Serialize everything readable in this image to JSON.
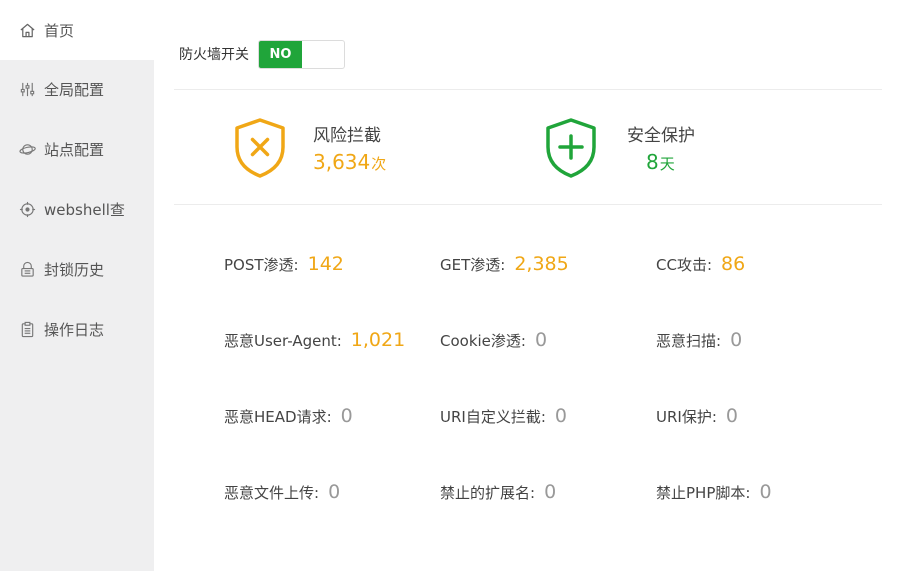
{
  "colors": {
    "accent_green": "#20a53a",
    "accent_orange": "#f0a716",
    "sidebar_bg": "#efeff0"
  },
  "sidebar": {
    "items": [
      {
        "label": "首页",
        "icon": "home-icon",
        "active": true
      },
      {
        "label": "全局配置",
        "icon": "sliders-icon",
        "active": false
      },
      {
        "label": "站点配置",
        "icon": "planet-icon",
        "active": false
      },
      {
        "label": "webshell查",
        "icon": "crosshair-icon",
        "active": false
      },
      {
        "label": "封锁历史",
        "icon": "lock-icon",
        "active": false
      },
      {
        "label": "操作日志",
        "icon": "clipboard-icon",
        "active": false
      }
    ]
  },
  "firewall": {
    "label": "防火墙开关",
    "toggle_text": "NO"
  },
  "summary": {
    "risk": {
      "title": "风险拦截",
      "value": "3,634",
      "unit": "次",
      "icon": "shield-x-icon"
    },
    "safe": {
      "title": "安全保护",
      "value": "8",
      "unit": "天",
      "icon": "shield-plus-icon"
    }
  },
  "metrics": [
    {
      "label": "POST渗透",
      "value": "142"
    },
    {
      "label": "GET渗透",
      "value": "2,385"
    },
    {
      "label": "CC攻击",
      "value": "86"
    },
    {
      "label": "恶意User-Agent",
      "value": "1,021"
    },
    {
      "label": "Cookie渗透",
      "value": "0"
    },
    {
      "label": "恶意扫描",
      "value": "0"
    },
    {
      "label": "恶意HEAD请求",
      "value": "0"
    },
    {
      "label": "URI自定义拦截",
      "value": "0"
    },
    {
      "label": "URI保护",
      "value": "0"
    },
    {
      "label": "恶意文件上传",
      "value": "0"
    },
    {
      "label": "禁止的扩展名",
      "value": "0"
    },
    {
      "label": "禁止PHP脚本",
      "value": "0"
    }
  ],
  "colon": ":"
}
